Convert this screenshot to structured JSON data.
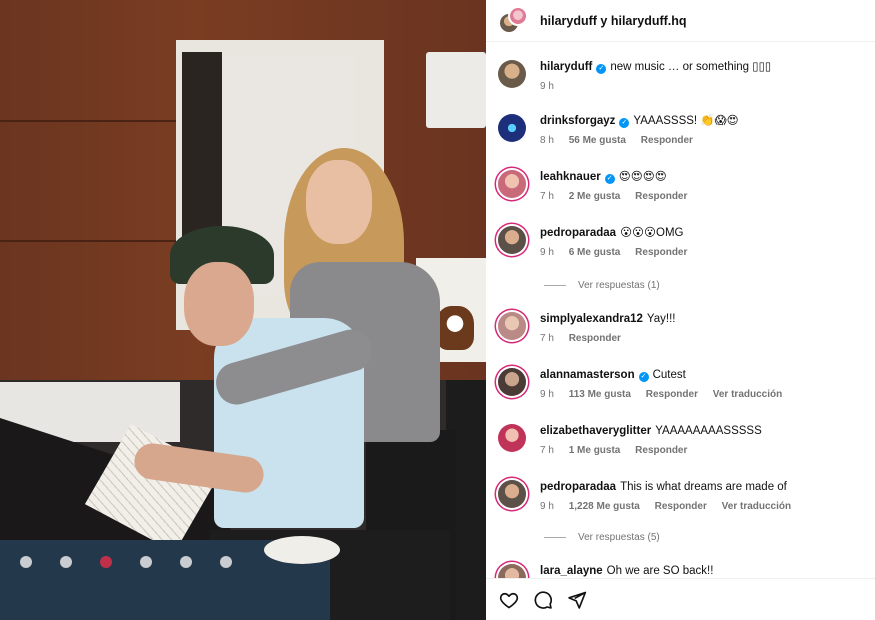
{
  "header": {
    "title": "hilaryduff y hilaryduff.hq"
  },
  "comments": [
    {
      "user": "hilaryduff",
      "verified": true,
      "text": "new music … or something ▯▯▯",
      "time": "9 h",
      "likes": "",
      "reply": "",
      "translate": "",
      "avatar_color": "#6a5a4a"
    },
    {
      "user": "drinksforgayz",
      "verified": true,
      "text": "YAAASSSS! 👏😱😍",
      "time": "8 h",
      "likes": "56 Me gusta",
      "reply": "Responder",
      "translate": "",
      "avatar_color": "#1d2f7a"
    },
    {
      "user": "leahknauer",
      "verified": true,
      "text": "😍😍😍😍",
      "time": "7 h",
      "likes": "2 Me gusta",
      "reply": "Responder",
      "translate": "",
      "avatar_color": "#c96a7a"
    },
    {
      "user": "pedroparadaa",
      "verified": false,
      "text": "😮😮😮OMG",
      "time": "9 h",
      "likes": "6 Me gusta",
      "reply": "Responder",
      "translate": "",
      "avatar_color": "#5b5148"
    },
    {
      "user": "simplyalexandra12",
      "verified": false,
      "text": "Yay!!!",
      "time": "7 h",
      "likes": "",
      "reply": "Responder",
      "translate": "",
      "avatar_color": "#b98a86"
    },
    {
      "user": "alannamasterson",
      "verified": true,
      "text": "Cutest",
      "time": "9 h",
      "likes": "113 Me gusta",
      "reply": "Responder",
      "translate": "Ver traducción",
      "avatar_color": "#4a3b36"
    },
    {
      "user": "elizabethaveryglitter",
      "verified": false,
      "text": "YAAAAAAAASSSSS",
      "time": "7 h",
      "likes": "1 Me gusta",
      "reply": "Responder",
      "translate": "",
      "avatar_color": "#c0345a"
    },
    {
      "user": "pedroparadaa",
      "verified": false,
      "text": "This is what dreams are made of",
      "time": "9 h",
      "likes": "1,228 Me gusta",
      "reply": "Responder",
      "translate": "Ver traducción",
      "avatar_color": "#5b5148"
    },
    {
      "user": "lara_alayne",
      "verified": false,
      "text": "Oh we are SO back!!",
      "time": "",
      "likes": "",
      "reply": "",
      "translate": "",
      "avatar_color": "#8a6a5a"
    }
  ],
  "view_replies": [
    {
      "label": "Ver respuestas (1)"
    },
    {
      "label": "Ver respuestas (5)"
    }
  ],
  "actions": {
    "like_icon": "heart-icon",
    "comment_icon": "comment-icon",
    "share_icon": "send-icon"
  },
  "colors": {
    "verified": "#0095f6",
    "meta_text": "#737373",
    "story_ring": "#d62976"
  }
}
